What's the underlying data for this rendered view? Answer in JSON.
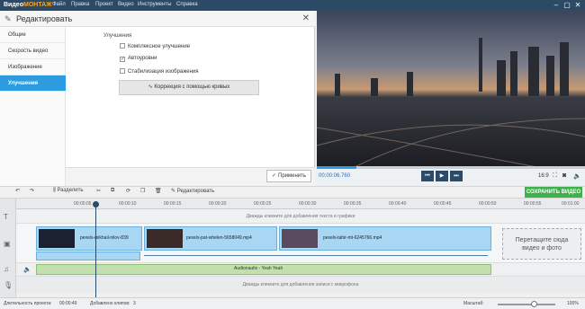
{
  "app": {
    "logo_prefix": "Видео",
    "logo_brand": "МОНТАЖ"
  },
  "menu": [
    "Файл",
    "Правка",
    "Проект",
    "Видео",
    "Инструменты",
    "Справка"
  ],
  "editor": {
    "title": "Редактировать",
    "tabs": [
      "Общие",
      "Скорость видео",
      "Изображение",
      "Улучшения"
    ],
    "active_tab": "Улучшения",
    "section_title": "Улучшения",
    "options": [
      {
        "label": "Комплексное улучшение",
        "checked": false
      },
      {
        "label": "Автоуровни",
        "checked": true
      },
      {
        "label": "Стабилизация изображения",
        "checked": false
      }
    ],
    "curves_button": "Коррекция с помощью кривых",
    "apply_button": "Применить"
  },
  "player": {
    "time": "00:00:06.760",
    "aspect": "16:9",
    "progress": 0.15
  },
  "toolbar": {
    "split": "Разделить",
    "edit": "Редактировать",
    "save": "СОХРАНИТЬ ВИДЕО"
  },
  "timeline": {
    "ticks": [
      "00:00:05",
      "00:00:10",
      "00:00:15",
      "00:00:20",
      "00:00:25",
      "00:00:30",
      "00:00:35",
      "00:00:40",
      "00:00:45",
      "00:00:50",
      "00:00:55",
      "00:01:00"
    ],
    "text_hint": "Дважды кликните для добавления текста и графики",
    "clips": [
      "pexels-mikhail-nilov-839",
      "pexels-pat-whelen-5658049.mp4",
      "pexels-tahir-mt-6245766.mp4"
    ],
    "drop_hint_line1": "Перетащите сюда",
    "drop_hint_line2": "видео и фото",
    "audio_name": "Audionautix - Yeah Yeah",
    "mic_hint": "Дважды кликните для добавления записи с микрофона"
  },
  "status": {
    "duration_label": "Длительность проекта:",
    "duration": "00:00:49",
    "clips_label": "Добавлено клипов:",
    "clips": "3",
    "zoom_label": "Масштаб:",
    "zoom": "100%"
  },
  "colors": {
    "accent": "#2d9be0",
    "save": "#3bb34a",
    "menubar": "#2c4a66"
  }
}
